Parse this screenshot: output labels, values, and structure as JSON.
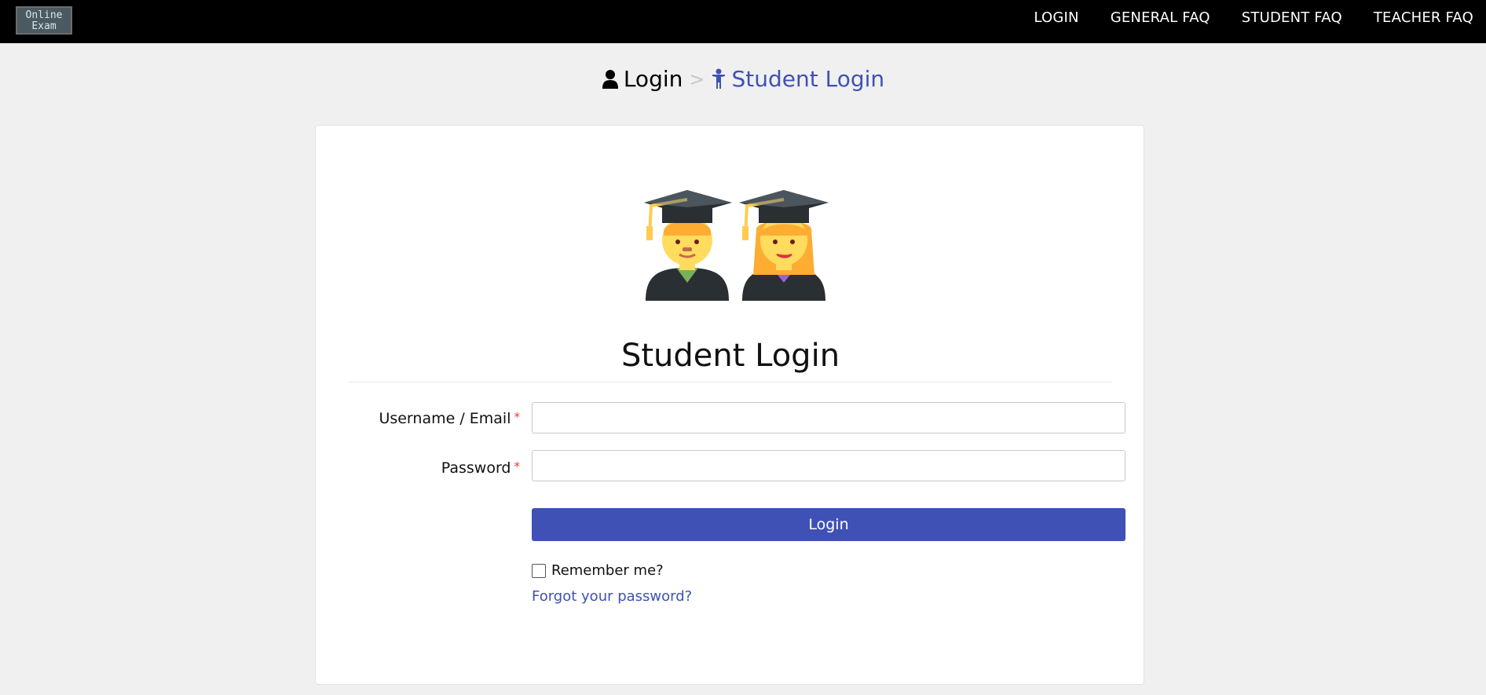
{
  "brand": {
    "logo_line1": "Online",
    "logo_line2": "Exam"
  },
  "nav": {
    "items": [
      {
        "label": "LOGIN"
      },
      {
        "label": "GENERAL FAQ"
      },
      {
        "label": "STUDENT FAQ"
      },
      {
        "label": "TEACHER FAQ"
      }
    ]
  },
  "breadcrumb": {
    "home_label": "Login",
    "home_icon": "user-icon",
    "separator": ">",
    "current_label": "Student Login",
    "current_icon": "child-icon"
  },
  "card": {
    "illustration": "graduates-icon",
    "title": "Student Login"
  },
  "form": {
    "username_label": "Username / Email",
    "username_value": "",
    "password_label": "Password",
    "password_value": "",
    "required_mark": "*",
    "submit_label": "Login",
    "remember_label": "Remember me?",
    "remember_checked": false,
    "forgot_label": "Forgot your password?"
  },
  "colors": {
    "accent": "#3f51b5",
    "navbar": "#000000",
    "background": "#f0f0f0",
    "required": "#e53935"
  }
}
